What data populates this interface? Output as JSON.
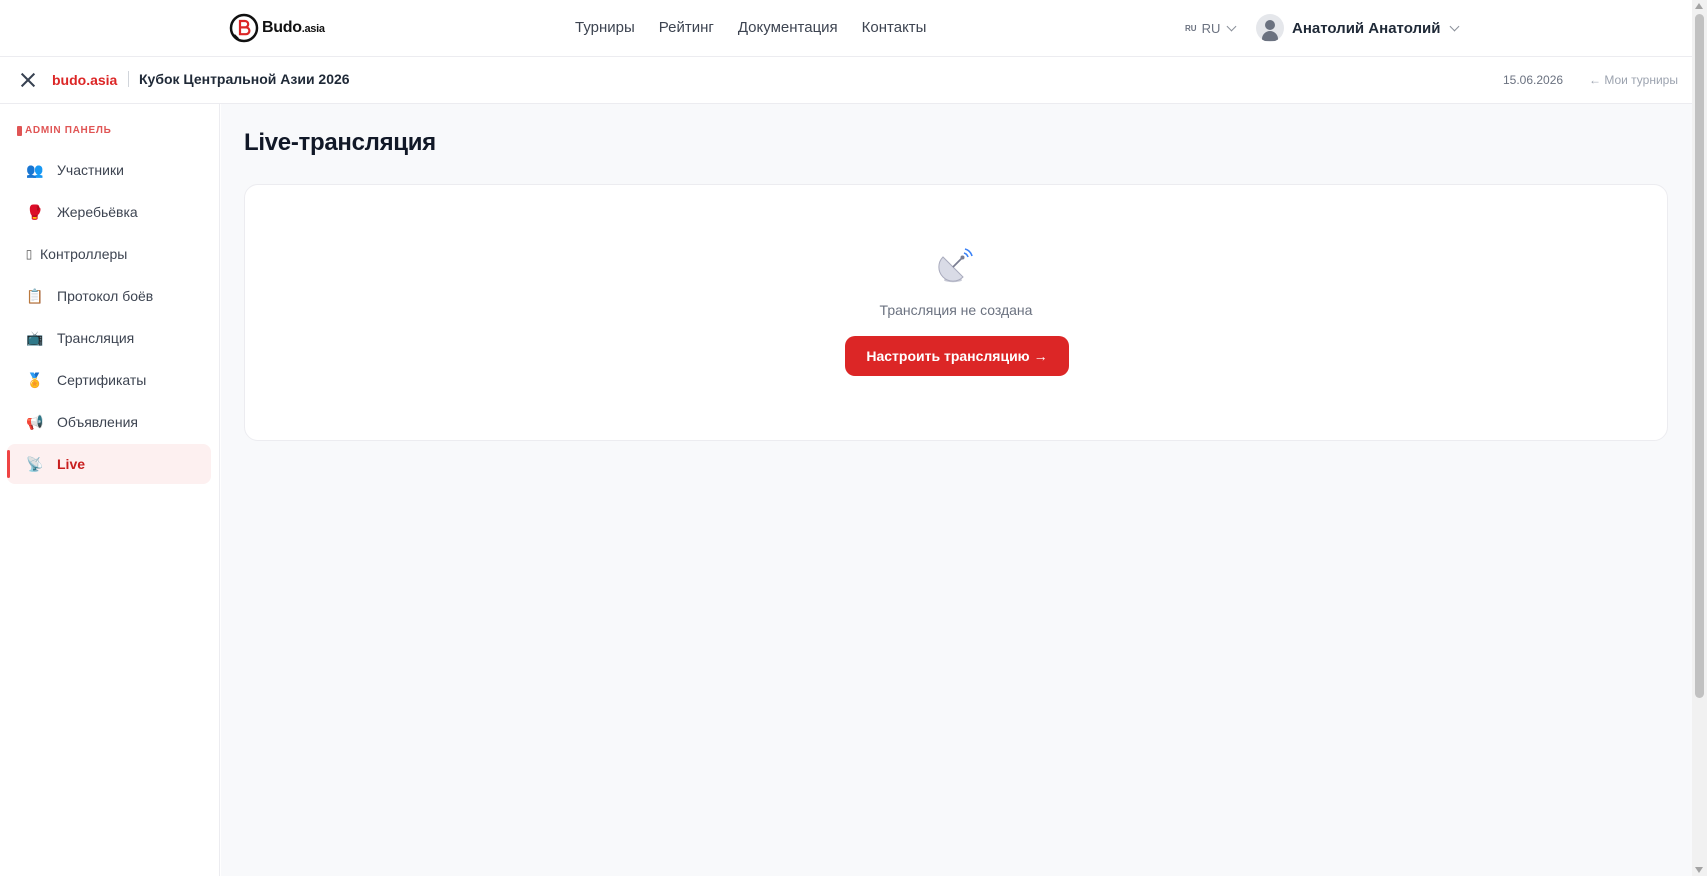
{
  "topnav": {
    "logo_text": "Budo",
    "logo_suffix": ".asia",
    "links": [
      "Турниры",
      "Рейтинг",
      "Документация",
      "Контакты"
    ],
    "lang_flag": "RU",
    "lang": "RU",
    "user_name": "Анатолий Анатолий"
  },
  "subbar": {
    "brand": "budo.asia",
    "tournament": "Кубок Центральной Азии 2026",
    "date": "15.06.2026",
    "back_link": "← Мои турниры"
  },
  "sidebar": {
    "section_label": "ADMIN ПАНЕЛЬ",
    "items": [
      {
        "label": "Участники",
        "icon": "people-icon",
        "glyph": "👥"
      },
      {
        "label": "Жеребьёвка",
        "icon": "boxing-glove-icon",
        "glyph": "🥊"
      },
      {
        "label": "Контроллеры",
        "icon": "remote-control-icon",
        "glyph": "▯"
      },
      {
        "label": "Протокол боёв",
        "icon": "clipboard-icon",
        "glyph": "📋"
      },
      {
        "label": "Трансляция",
        "icon": "tv-icon",
        "glyph": "📺"
      },
      {
        "label": "Сертификаты",
        "icon": "medal-icon",
        "glyph": "🏅"
      },
      {
        "label": "Объявления",
        "icon": "megaphone-icon",
        "glyph": "📢"
      },
      {
        "label": "Live",
        "icon": "satellite-icon",
        "glyph": "📡",
        "active": true
      }
    ]
  },
  "main": {
    "title": "Live-трансляция",
    "empty_text": "Трансляция не создана",
    "cta_label": "Настроить трансляцию",
    "cta_arrow": "→"
  },
  "colors": {
    "accent": "#dc2626",
    "active_bg": "#fdf0f0",
    "page_bg": "#f8f9fb"
  }
}
